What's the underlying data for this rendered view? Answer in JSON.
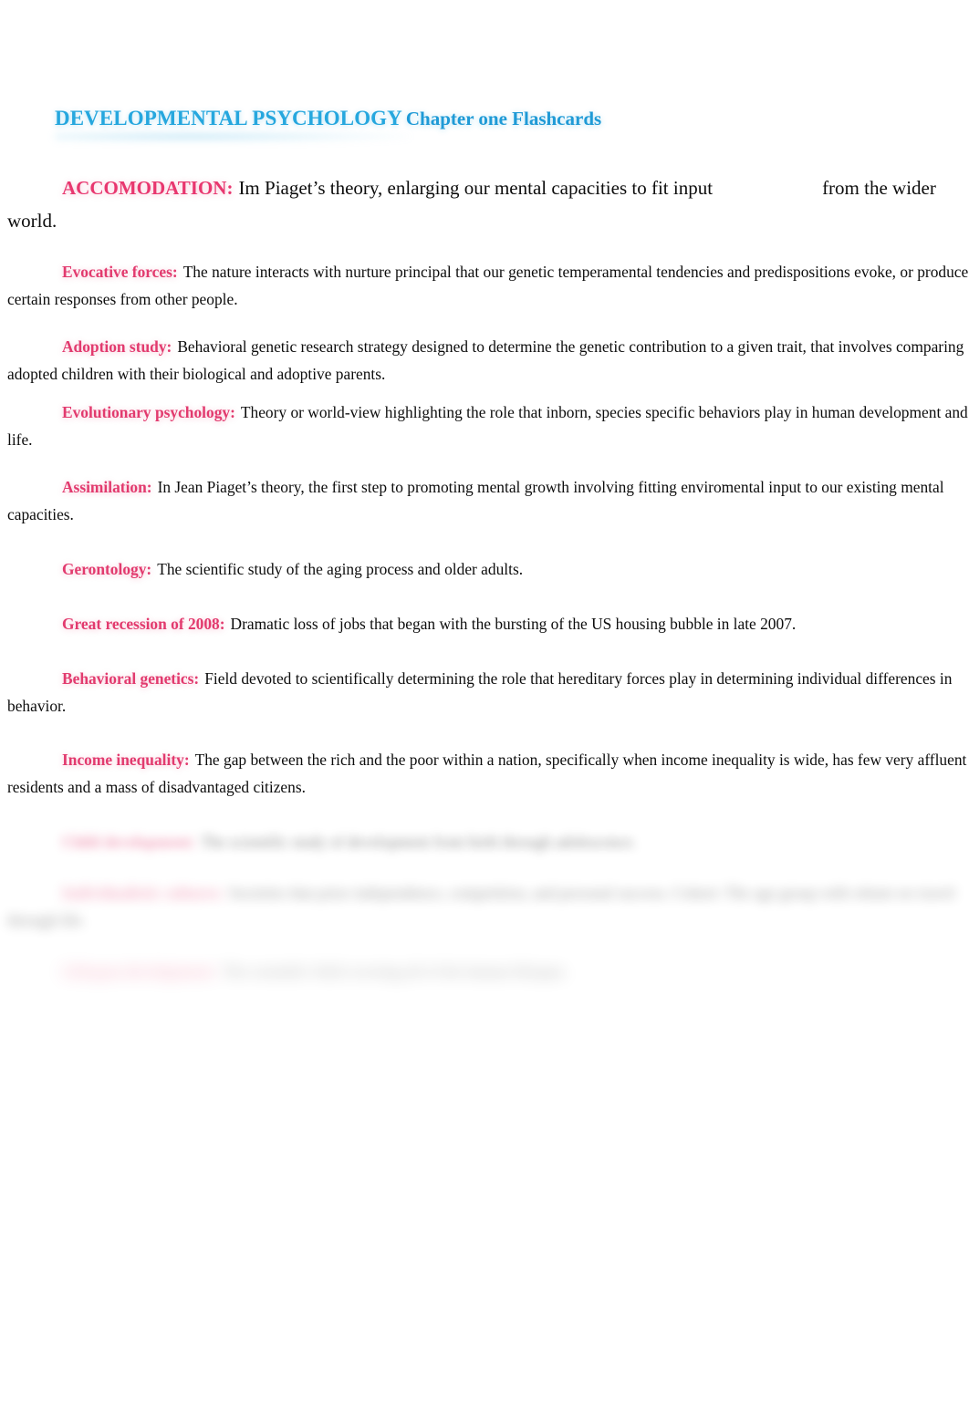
{
  "document": {
    "title": "DEVELOPMENTAL PSYCHOLOGY",
    "subtitle": "Chapter one Flashcards"
  },
  "colors": {
    "heading_blue": "#26a7de",
    "subtitle_blue": "#1f9ad6",
    "term_pink": "#e23a6e",
    "body_black": "#0d0d0d",
    "page_background": "#ffffff"
  },
  "entries": [
    {
      "term": "ACCOMODATION:",
      "definition_part1": "Im Piaget’s theory, enlarging our mental capacities to fit input",
      "definition_part2": "from the wider world.",
      "truncated_at_right_edge": "from"
    },
    {
      "term": "Evocative forces:",
      "definition": "The nature interacts with nurture principal that our genetic temperamental tendencies and predispositions evoke, or produce certain responses from other people."
    },
    {
      "term": "Adoption study:",
      "definition": "Behavioral genetic research strategy designed to determine the genetic contribution to a given trait, that involves comparing adopted children with their biological and adoptive parents."
    },
    {
      "term": "Evolutionary psychology:",
      "definition": "Theory or world-view highlighting the role that inborn, species specific behaviors play in human development and life."
    },
    {
      "term": "Assimilation:",
      "definition": "In Jean Piaget’s theory, the first step to promoting mental growth involving fitting enviromental input to our existing mental capacities."
    },
    {
      "term": "Gerontology:",
      "definition": "The scientific study of the aging process and older adults."
    },
    {
      "term": "Great recession of 2008:",
      "definition": "Dramatic loss of jobs that began with the bursting of the US housing bubble in late 2007."
    },
    {
      "term": "Behavioral genetics:",
      "definition": "Field devoted to scientifically determining the role that hereditary forces play in determining individual differences in behavior."
    },
    {
      "term": "Income inequality:",
      "definition": "The gap between the rich and the poor within a nation, specifically when income inequality is wide, has few very affluent residents and a mass of disadvantaged citizens."
    }
  ],
  "obscured_entries": [
    {
      "term": "Child development:",
      "definition": "The scientific study of development from birth through adolescence.",
      "blur_level": 1
    },
    {
      "term": "Individualistic cultures:",
      "definition": "Societies that prize independence, competition, and personal success.  Cohort: The age group with whom we travel through life.",
      "blur_level": 2
    },
    {
      "term": "Lifespan development:",
      "definition": "The scientific field covering all of the human lifespan.",
      "blur_level": 3
    }
  ]
}
